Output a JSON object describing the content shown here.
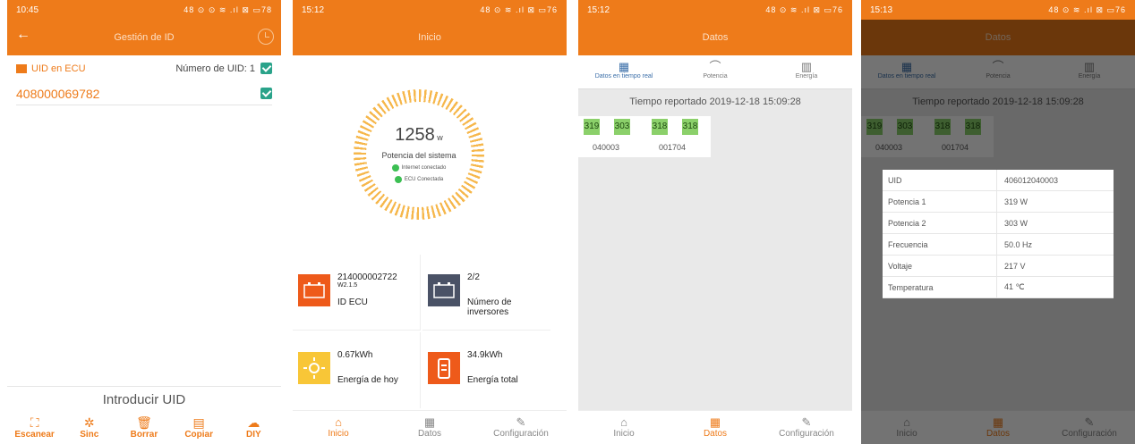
{
  "s1": {
    "time": "10:45",
    "status_icons": "48 ⊙ ⊙ ≋ .ıl ⊠ ▭78",
    "title": "Gestión de ID",
    "uid_label": "UID en ECU",
    "uid_count": "Número de UID: 1",
    "uid": "408000069782",
    "input_label": "Introducir UID",
    "tools": [
      {
        "icon": "scan-icon",
        "glyph": "⛶",
        "label": "Escanear"
      },
      {
        "icon": "sync-icon",
        "glyph": "✲",
        "label": "Sinc"
      },
      {
        "icon": "trash-icon",
        "glyph": "🗑",
        "label": "Borrar"
      },
      {
        "icon": "copy-icon",
        "glyph": "▤",
        "label": "Copiar"
      },
      {
        "icon": "cloud-upload-icon",
        "glyph": "☁",
        "label": "DIY"
      }
    ]
  },
  "s2": {
    "time": "15:12",
    "status_icons": "48 ⊙ ≋ .ıl ⊠ ▭76",
    "title": "Inicio",
    "power": "1258",
    "power_unit": "w",
    "power_label": "Potencia del sistema",
    "internet": "Internet conectado",
    "ecu": "ECU Conectada",
    "ecu_id": "214000002722",
    "ecu_ver": "W2.1.5",
    "ecu_id_label": "ID ECU",
    "inverters": "2/2",
    "inverters_label": "Número de inversores",
    "today": "0.67kWh",
    "today_label": "Energía de hoy",
    "total": "34.9kWh",
    "total_label": "Energía total",
    "nav": [
      "Inicio",
      "Datos",
      "Configuración"
    ]
  },
  "s3": {
    "time": "15:12",
    "status_icons": "48 ⊙ ≋ .ıl ⊠ ▭76",
    "title": "Datos",
    "tabs": [
      "Datos en tiempo real",
      "Potencia",
      "Energía"
    ],
    "reported": "Tiempo reportado  2019-12-18 15:09:28",
    "panels": [
      "319",
      "303",
      "318",
      "318"
    ],
    "ids": [
      "040003",
      "001704"
    ],
    "nav": [
      "Inicio",
      "Datos",
      "Configuración"
    ]
  },
  "s4": {
    "time": "15:13",
    "status_icons": "48 ⊙ ≋ .ıl ⊠ ▭76",
    "rows": [
      [
        "UID",
        "406012040003"
      ],
      [
        "Potencia 1",
        "319 W"
      ],
      [
        "Potencia 2",
        "303 W"
      ],
      [
        "Frecuencia",
        "50.0 Hz"
      ],
      [
        "Voltaje",
        "217 V"
      ],
      [
        "Temperatura",
        "41 ℃"
      ]
    ]
  },
  "colors": {
    "accent": "#ee7b1a",
    "check": "#2aa38a",
    "panel": "#8bd06a"
  }
}
